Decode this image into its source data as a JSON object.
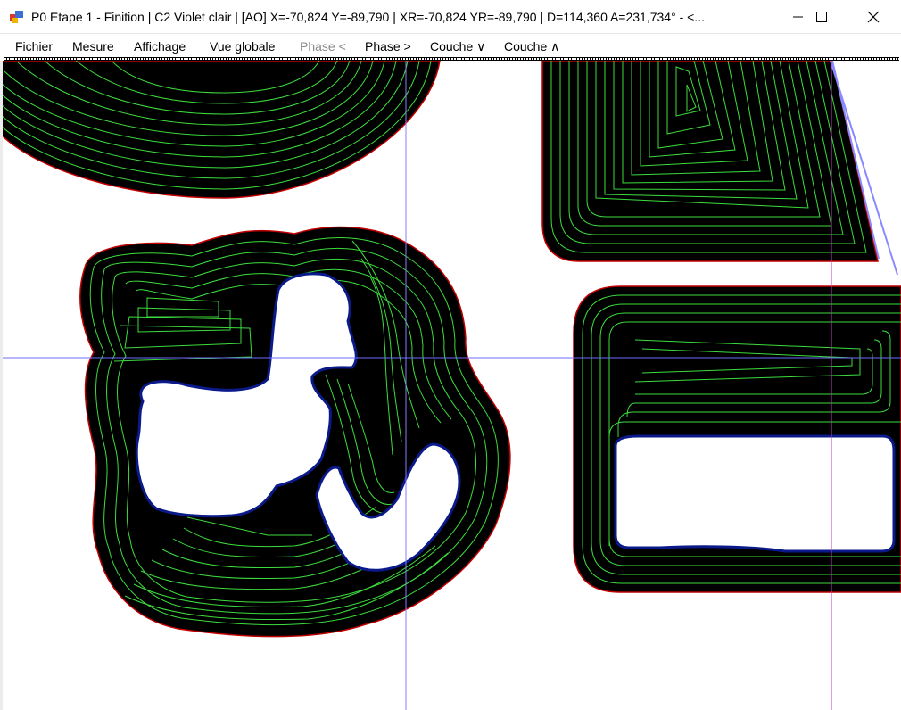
{
  "window": {
    "title": "P0 Etape 1 - Finition | C2 Violet clair | [AO] X=-70,824  Y=-89,790 | XR=-70,824 YR=-89,790 | D=114,360 A=231,734° - <...",
    "controls": {
      "minimize": "minimize-icon",
      "maximize": "maximize-icon",
      "close": "close-icon"
    }
  },
  "menu": {
    "items": [
      {
        "label": "Fichier",
        "enabled": true
      },
      {
        "label": "Mesure",
        "enabled": true
      },
      {
        "label": "Affichage",
        "enabled": true
      },
      {
        "label": "Vue globale",
        "enabled": true
      },
      {
        "label": "Phase <",
        "enabled": false
      },
      {
        "label": "Phase >",
        "enabled": true
      },
      {
        "label": "Couche ∨",
        "enabled": true
      },
      {
        "label": "Couche ∧",
        "enabled": true
      }
    ]
  },
  "colors": {
    "background": "#ffffff",
    "part_fill": "#000000",
    "part_outline": "#c00000",
    "hole_outline": "#0a1a8a",
    "toolpath": "#3ddc3d",
    "crosshair_h": "#6c6cff",
    "crosshair_v_left": "#8a7cff",
    "crosshair_v_right": "#c040c0",
    "boundary": "#8a8aff"
  }
}
